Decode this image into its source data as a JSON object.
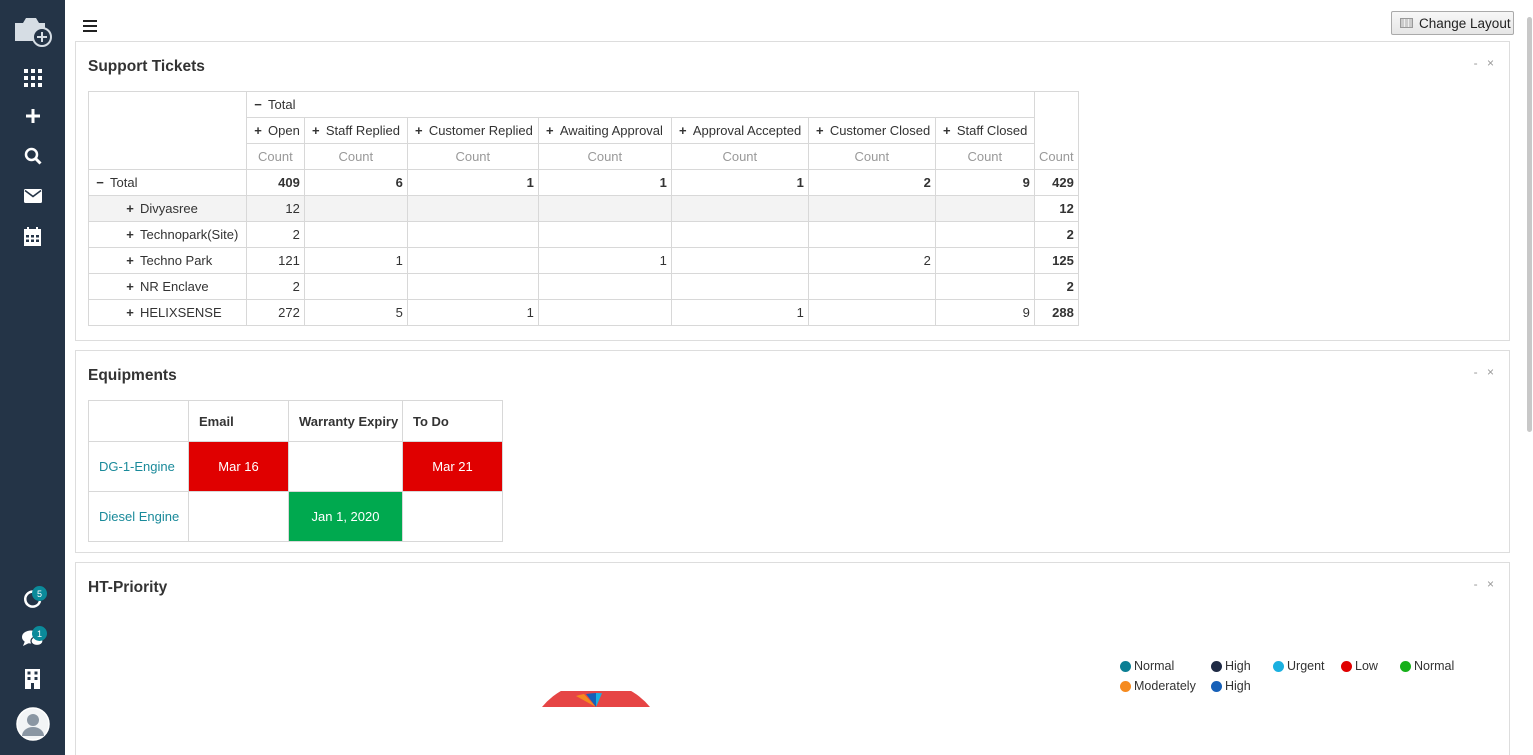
{
  "sidebar": {
    "notifications_badge": "5",
    "messages_badge": "1"
  },
  "header": {
    "change_layout_label": "Change Layout"
  },
  "support_tickets": {
    "title": "Support Tickets",
    "controls": "- ×",
    "total_label": "Total",
    "columns": [
      "Open",
      "Staff Replied",
      "Customer Replied",
      "Awaiting Approval",
      "Approval Accepted",
      "Customer Closed",
      "Staff Closed"
    ],
    "count_label": "Count",
    "total_row": {
      "label": "Total",
      "values": [
        "409",
        "6",
        "1",
        "1",
        "1",
        "2",
        "9"
      ],
      "total": "429"
    },
    "rows": [
      {
        "label": "Divyasree",
        "values": [
          "12",
          "",
          "",
          "",
          "",
          "",
          ""
        ],
        "total": "12"
      },
      {
        "label": "Technopark(Site)",
        "values": [
          "2",
          "",
          "",
          "",
          "",
          "",
          ""
        ],
        "total": "2"
      },
      {
        "label": "Techno Park",
        "values": [
          "121",
          "1",
          "",
          "1",
          "",
          "2",
          ""
        ],
        "total": "125"
      },
      {
        "label": "NR Enclave",
        "values": [
          "2",
          "",
          "",
          "",
          "",
          "",
          ""
        ],
        "total": "2"
      },
      {
        "label": "HELIXSENSE",
        "values": [
          "272",
          "5",
          "1",
          "",
          "1",
          "",
          "9"
        ],
        "total": "288"
      }
    ]
  },
  "equipments": {
    "title": "Equipments",
    "controls": "- ×",
    "headers": [
      "Email",
      "Warranty Expiry",
      "To Do"
    ],
    "rows": [
      {
        "name": "DG-1-Engine",
        "email": "Mar 16",
        "warranty": "",
        "todo": "Mar 21"
      },
      {
        "name": "Diesel Engine",
        "email": "",
        "warranty": "Jan 1, 2020",
        "todo": ""
      }
    ],
    "colors": {
      "red": "#e00000",
      "green": "#00a94f"
    }
  },
  "ht_priority": {
    "title": "HT-Priority",
    "controls": "- ×",
    "legend": [
      {
        "label": "Normal",
        "color": "#0b7f94"
      },
      {
        "label": "High",
        "color": "#1f2a44"
      },
      {
        "label": "Urgent",
        "color": "#1ab0e0"
      },
      {
        "label": "Low",
        "color": "#e00000"
      },
      {
        "label": "Normal",
        "color": "#16b01a"
      },
      {
        "label": "Moderately",
        "color": "#f58a1f"
      },
      {
        "label": "High",
        "color": "#1660b8"
      }
    ]
  }
}
